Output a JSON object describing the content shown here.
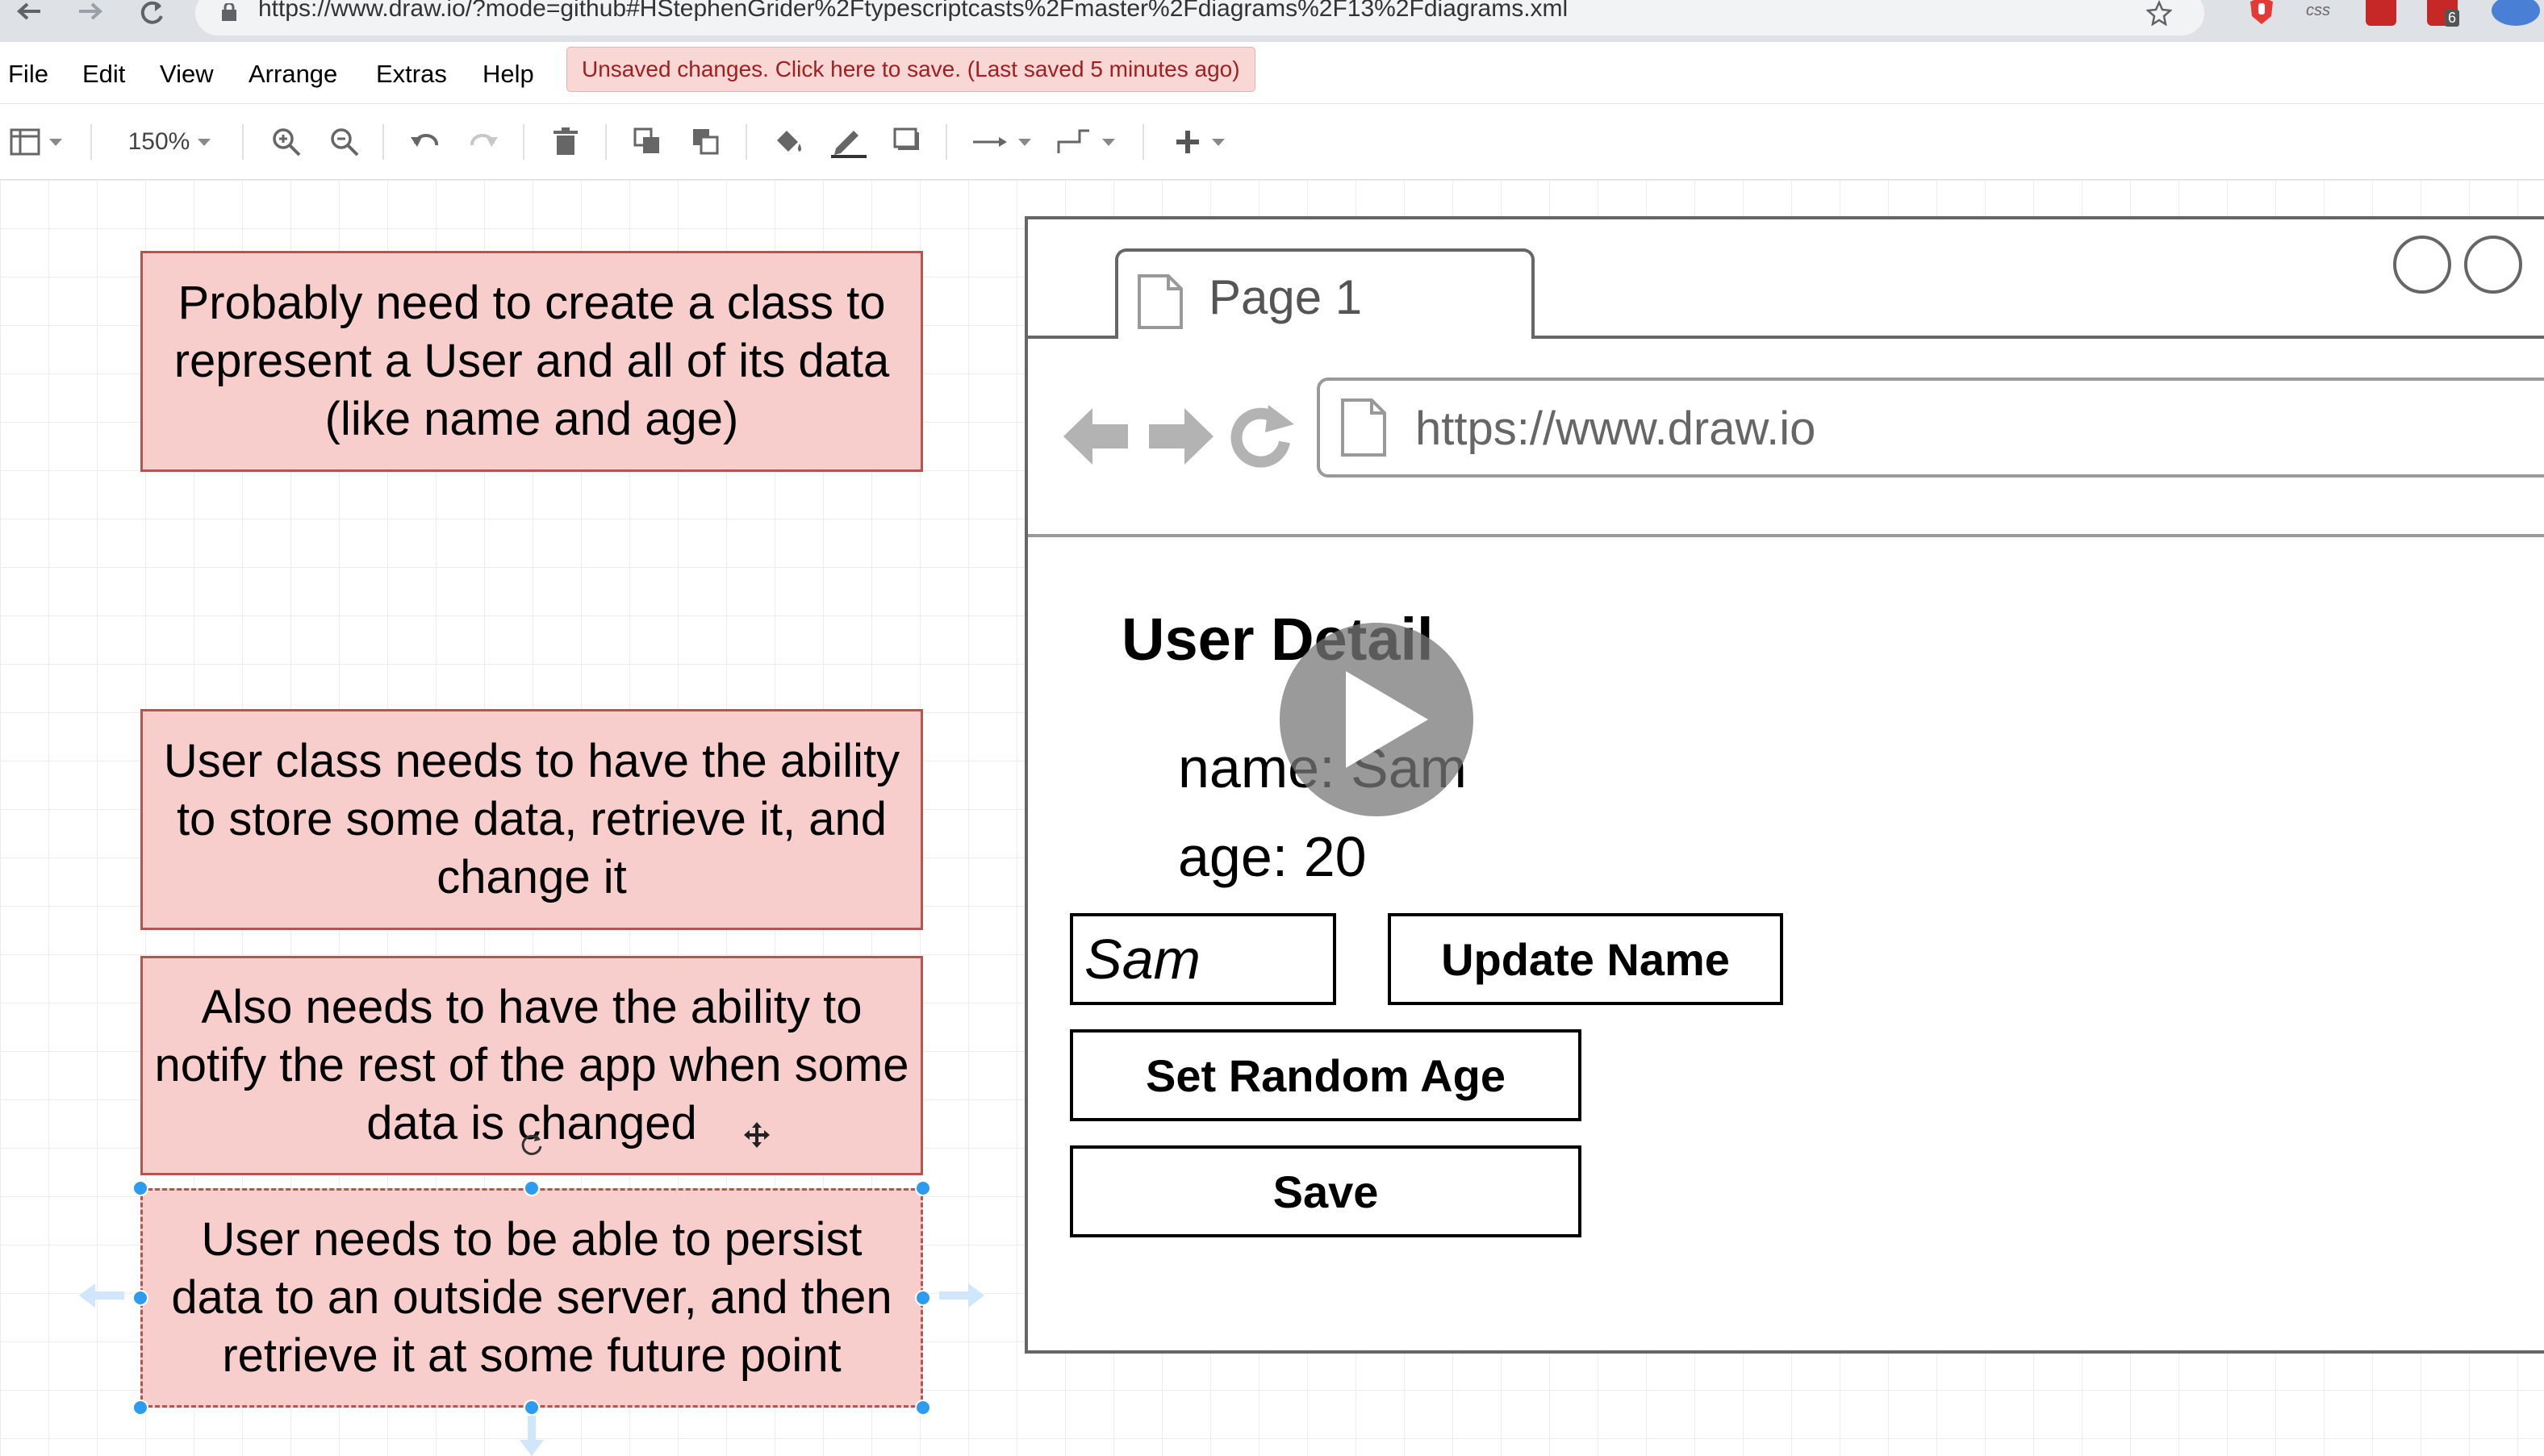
{
  "browser": {
    "url": "https://www.draw.io/?mode=github#HStephenGrider%2Ftypescriptcasts%2Fmaster%2Fdiagrams%2F13%2Fdiagrams.xml",
    "extensions": [
      "adblock-icon",
      "css-icon",
      "dots-extension-icon",
      "extension-icon"
    ],
    "extension_badge": "6",
    "extension_css_label": "css"
  },
  "menu": {
    "items": [
      "File",
      "Edit",
      "View",
      "Arrange",
      "Extras",
      "Help"
    ],
    "unsaved_notice": "Unsaved changes. Click here to save. (Last saved 5 minutes ago)"
  },
  "toolbar": {
    "zoom": "150%"
  },
  "notes": [
    {
      "text": "Probably need to create a class to represent a User and all of its data (like name and age)"
    },
    {
      "text": "User class needs to have the ability to store some data, retrieve it, and change it"
    },
    {
      "text": "Also needs to have the ability to notify the rest of the app when some data is changed"
    },
    {
      "text": "User needs to be able to persist data to an outside server, and then retrieve it at some future point"
    }
  ],
  "mockup": {
    "tab_label": "Page 1",
    "url": "https://www.draw.io",
    "heading": "User Detail",
    "name_line": "name: Sam",
    "age_line": "age: 20",
    "name_input_value": "Sam",
    "update_button": "Update Name",
    "random_age_button": "Set Random Age",
    "save_button": "Save"
  },
  "colors": {
    "note_fill": "#f8cecc",
    "note_border": "#b85450",
    "selection_handle": "#2d9bf0",
    "unsaved_bg": "#f8d7d5",
    "unsaved_text": "#a11f1f"
  }
}
